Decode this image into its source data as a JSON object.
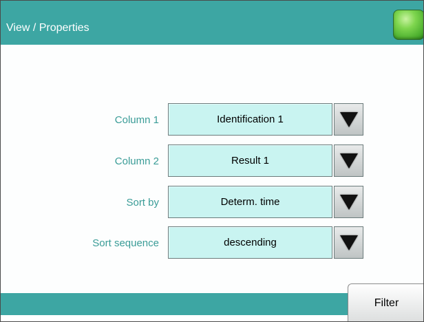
{
  "header": {
    "title": "View / Properties",
    "status_indicator_color": "#5cc23a"
  },
  "rows": [
    {
      "label": "Column 1",
      "value": "Identification 1"
    },
    {
      "label": "Column 2",
      "value": "Result 1"
    },
    {
      "label": "Sort by",
      "value": "Determ. time"
    },
    {
      "label": "Sort sequence",
      "value": "descending"
    }
  ],
  "footer": {
    "filter_label": "Filter"
  },
  "colors": {
    "accent": "#3da6a3",
    "label_text": "#3a9c97",
    "field_bg": "#c9f4f1"
  },
  "icons": {
    "dropdown": "triangle-down-icon"
  }
}
